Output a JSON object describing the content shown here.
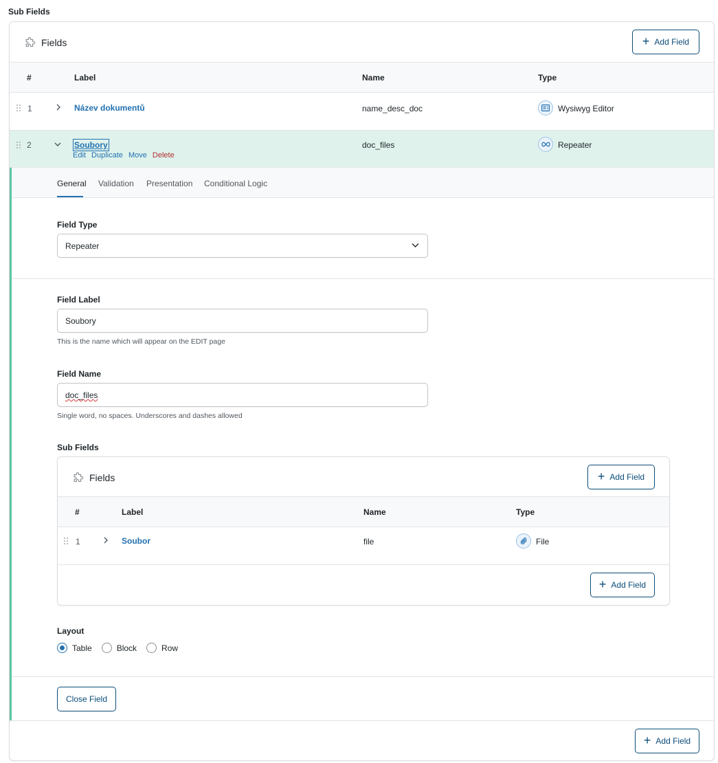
{
  "page_label": "Sub Fields",
  "panel": {
    "title": "Fields",
    "add_label": "Add Field",
    "columns": {
      "num": "#",
      "label": "Label",
      "name": "Name",
      "type": "Type"
    },
    "rows": [
      {
        "num": "1",
        "label": "Název dokumentů",
        "name": "name_desc_doc",
        "type": "Wysiwyg Editor",
        "type_icon": "wysiwyg-icon"
      },
      {
        "num": "2",
        "label": "Soubory",
        "name": "doc_files",
        "type": "Repeater",
        "type_icon": "infinity-icon"
      }
    ],
    "row_actions": {
      "edit": "Edit",
      "duplicate": "Duplicate",
      "move": "Move",
      "delete": "Delete"
    },
    "footer_add_label": "Add Field"
  },
  "settings": {
    "tabs": [
      "General",
      "Validation",
      "Presentation",
      "Conditional Logic"
    ],
    "active_tab": "General",
    "field_type": {
      "label": "Field Type",
      "value": "Repeater"
    },
    "field_label": {
      "label": "Field Label",
      "value": "Soubory",
      "help": "This is the name which will appear on the EDIT page"
    },
    "field_name": {
      "label": "Field Name",
      "value": "doc_files",
      "help": "Single word, no spaces. Underscores and dashes allowed"
    },
    "sub_fields": {
      "label": "Sub Fields",
      "title": "Fields",
      "add_label": "Add Field",
      "columns": {
        "num": "#",
        "label": "Label",
        "name": "Name",
        "type": "Type"
      },
      "rows": [
        {
          "num": "1",
          "label": "Soubor",
          "name": "file",
          "type": "File",
          "type_icon": "paperclip-icon"
        }
      ],
      "footer_add_label": "Add Field"
    },
    "layout": {
      "label": "Layout",
      "options": [
        "Table",
        "Block",
        "Row"
      ],
      "selected": "Table"
    },
    "close_label": "Close Field"
  },
  "colors": {
    "accent": "#2271b1",
    "button": "#0a4b78",
    "open_row": "#dff2ec",
    "open_border": "#5fc4a4",
    "delete": "#b32d2e"
  }
}
